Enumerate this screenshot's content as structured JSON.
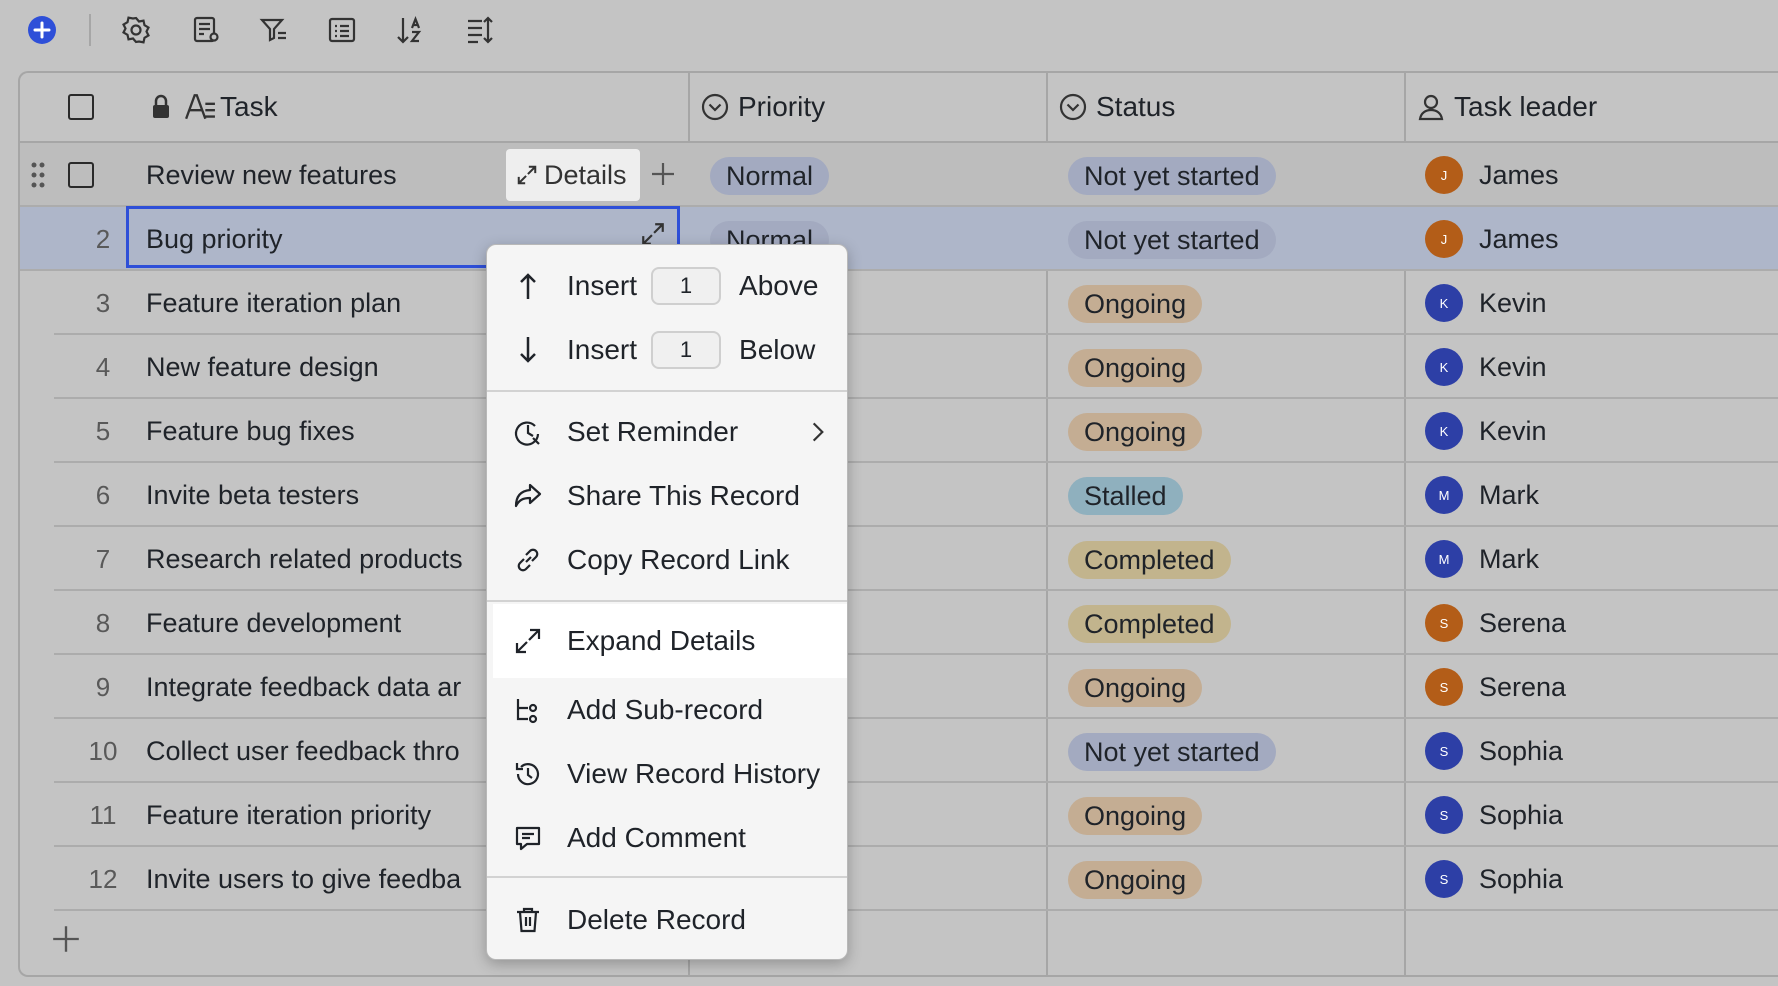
{
  "toolbar": {
    "icons": [
      "add-icon",
      "settings-icon",
      "form-settings-icon",
      "filter-icon",
      "list-view-icon",
      "sort-icon",
      "row-height-icon"
    ]
  },
  "header": {
    "task": "Task",
    "priority": "Priority",
    "status": "Status",
    "task_leader": "Task leader"
  },
  "first_row": {
    "name": "Review new features",
    "details_label": "Details",
    "priority": "Normal",
    "status": "Not yet started",
    "leader": "James",
    "leader_initial": "J"
  },
  "rows": [
    {
      "num": "2",
      "name": "Bug priority",
      "priority": "Normal",
      "status": "Not yet started",
      "leader": "James",
      "initial": "J"
    },
    {
      "num": "3",
      "name": "Feature iteration plan",
      "status": "Ongoing",
      "leader": "Kevin",
      "initial": "K"
    },
    {
      "num": "4",
      "name": "New feature design",
      "status": "Ongoing",
      "leader": "Kevin",
      "initial": "K"
    },
    {
      "num": "5",
      "name": "Feature bug fixes",
      "status": "Ongoing",
      "leader": "Kevin",
      "initial": "K"
    },
    {
      "num": "6",
      "name": "Invite beta testers",
      "status": "Stalled",
      "leader": "Mark",
      "initial": "M"
    },
    {
      "num": "7",
      "name": "Research related products",
      "status": "Completed",
      "leader": "Mark",
      "initial": "M"
    },
    {
      "num": "8",
      "name": "Feature development",
      "status": "Completed",
      "leader": "Serena",
      "initial": "S"
    },
    {
      "num": "9",
      "name": "Integrate feedback data ar",
      "status": "Ongoing",
      "leader": "Serena",
      "initial": "S"
    },
    {
      "num": "10",
      "name": "Collect user feedback thro",
      "status": "Not yet started",
      "leader": "Sophia",
      "initial": "S"
    },
    {
      "num": "11",
      "name": "Feature iteration priority",
      "status": "Ongoing",
      "leader": "Sophia",
      "initial": "S"
    },
    {
      "num": "12",
      "name": "Invite users to give feedba",
      "status": "Ongoing",
      "leader": "Sophia",
      "initial": "S"
    }
  ],
  "partial_text": "t",
  "context_menu": {
    "insert_label": "Insert",
    "insert_above_count": "1",
    "above_label": "Above",
    "insert_below_count": "1",
    "below_label": "Below",
    "set_reminder": "Set Reminder",
    "share_record": "Share This Record",
    "copy_link": "Copy Record Link",
    "expand_details": "Expand Details",
    "add_sub_record": "Add Sub-record",
    "view_history": "View Record History",
    "add_comment": "Add Comment",
    "delete_record": "Delete Record"
  },
  "colors": {
    "accent": "#2e4fd8",
    "selected_row": "#aeb6c9",
    "menu_bg": "#f5f5f5"
  }
}
